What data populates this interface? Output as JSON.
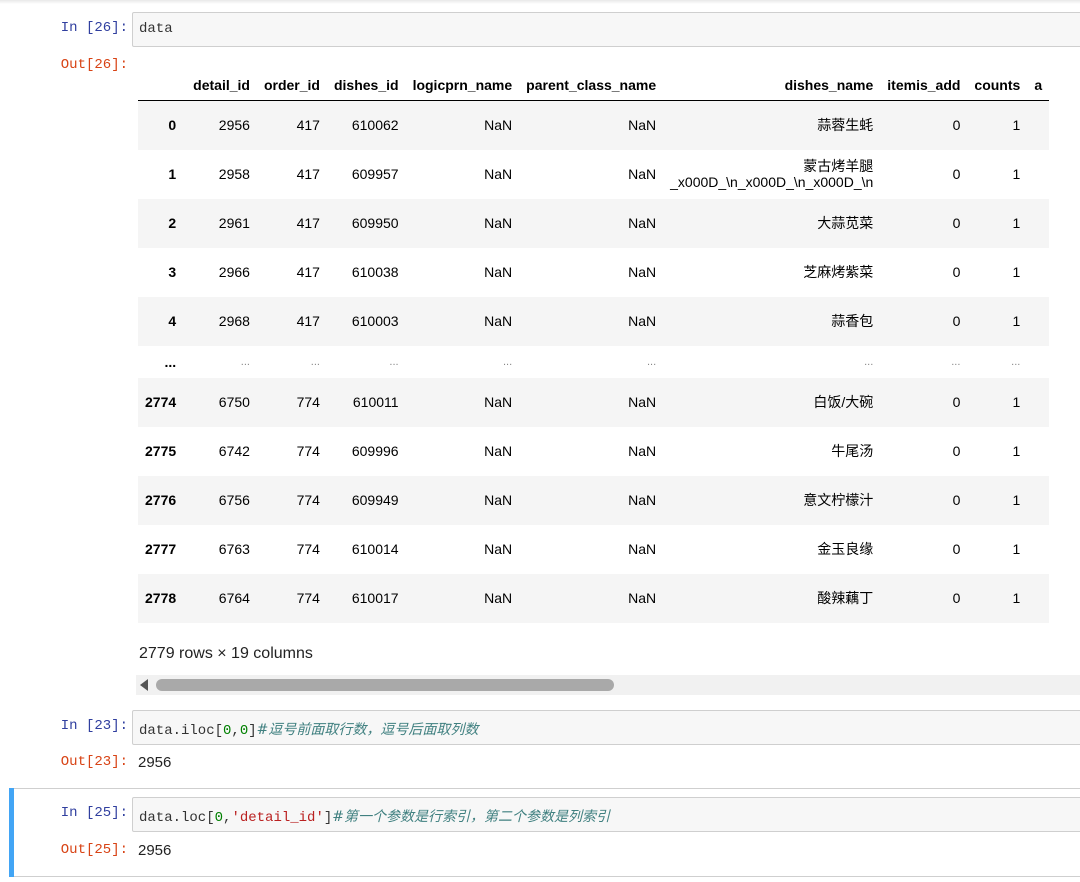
{
  "cells": {
    "c26": {
      "in_prompt": "In  [26]:",
      "out_prompt": "Out[26]:",
      "code": "data"
    },
    "c23": {
      "in_prompt": "In  [23]:",
      "out_prompt": "Out[23]:",
      "code_a": "data.iloc[",
      "num1": "0",
      "comma": ",",
      "num2": "0",
      "code_b": "]",
      "comment": "#逗号前面取行数，逗号后面取列数",
      "output": "2956"
    },
    "c25": {
      "in_prompt": "In  [25]:",
      "out_prompt": "Out[25]:",
      "code_a": "data.loc[",
      "num1": "0",
      "comma": ",",
      "str": "'detail_id'",
      "code_b": "]",
      "comment": "#第一个参数是行索引，第二个参数是列索引",
      "output": "2956"
    }
  },
  "dataframe": {
    "columns": [
      "",
      "detail_id",
      "order_id",
      "dishes_id",
      "logicprn_name",
      "parent_class_name",
      "dishes_name",
      "itemis_add",
      "counts",
      "a"
    ],
    "rows": [
      [
        "0",
        "2956",
        "417",
        "610062",
        "NaN",
        "NaN",
        "蒜蓉生蚝",
        "0",
        "1"
      ],
      [
        "1",
        "2958",
        "417",
        "609957",
        "NaN",
        "NaN",
        "蒙古烤羊腿\n_x000D_\\n_x000D_\\n_x000D_\\n",
        "0",
        "1"
      ],
      [
        "2",
        "2961",
        "417",
        "609950",
        "NaN",
        "NaN",
        "大蒜苋菜",
        "0",
        "1"
      ],
      [
        "3",
        "2966",
        "417",
        "610038",
        "NaN",
        "NaN",
        "芝麻烤紫菜",
        "0",
        "1"
      ],
      [
        "4",
        "2968",
        "417",
        "610003",
        "NaN",
        "NaN",
        "蒜香包",
        "0",
        "1"
      ],
      [
        "...",
        "...",
        "...",
        "...",
        "...",
        "...",
        "...",
        "...",
        "..."
      ],
      [
        "2774",
        "6750",
        "774",
        "610011",
        "NaN",
        "NaN",
        "白饭/大碗",
        "0",
        "1"
      ],
      [
        "2775",
        "6742",
        "774",
        "609996",
        "NaN",
        "NaN",
        "牛尾汤",
        "0",
        "1"
      ],
      [
        "2776",
        "6756",
        "774",
        "609949",
        "NaN",
        "NaN",
        "意文柠檬汁",
        "0",
        "1"
      ],
      [
        "2777",
        "6763",
        "774",
        "610014",
        "NaN",
        "NaN",
        "金玉良缘",
        "0",
        "1"
      ],
      [
        "2778",
        "6764",
        "774",
        "610017",
        "NaN",
        "NaN",
        "酸辣藕丁",
        "0",
        "1"
      ]
    ],
    "shape_text": "2779 rows × 19 columns"
  },
  "colors": {
    "in_prompt": "#303f9f",
    "out_prompt": "#d84315",
    "selected_cell": "#42a5f5",
    "comment": "#408080"
  },
  "icons": {
    "scroll_left": "scroll-left-arrow-icon"
  }
}
